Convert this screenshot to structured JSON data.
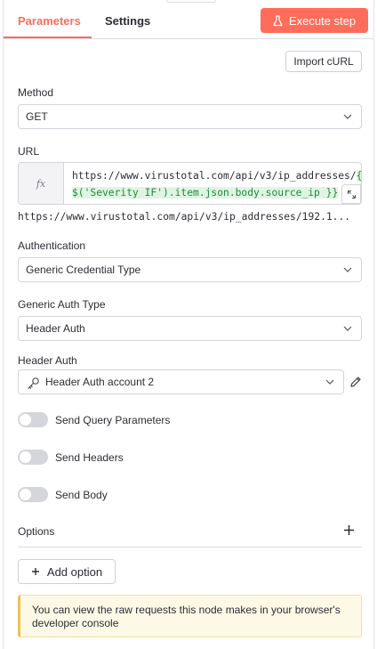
{
  "tabs": [
    {
      "label": "Parameters",
      "active": true
    },
    {
      "label": "Settings",
      "active": false
    }
  ],
  "execute_button": {
    "label": "Execute step",
    "icon": "flask-icon"
  },
  "import_button": {
    "label": "Import cURL"
  },
  "method": {
    "label": "Method",
    "value": "GET"
  },
  "url": {
    "label": "URL",
    "fx_label": "fx",
    "line1_prefix": "https://www.virustotal.com/api/v3/ip_addresses/",
    "line1_expr": "{{",
    "line2_expr": " $('Severity IF').item.json.body.source_ip }}",
    "preview": "https://www.virustotal.com/api/v3/ip_addresses/192.1..."
  },
  "authentication": {
    "label": "Authentication",
    "value": "Generic Credential Type"
  },
  "generic_auth_type": {
    "label": "Generic Auth Type",
    "value": "Header Auth"
  },
  "header_auth": {
    "label": "Header Auth",
    "value": "Header Auth account 2"
  },
  "toggles": [
    {
      "label": "Send Query Parameters",
      "enabled": false
    },
    {
      "label": "Send Headers",
      "enabled": false
    },
    {
      "label": "Send Body",
      "enabled": false
    }
  ],
  "options": {
    "label": "Options",
    "add_label": "Add option"
  },
  "notice": {
    "text": "You can view the raw requests this node makes in your browser's developer console"
  },
  "colors": {
    "accent": "#ff6d5a",
    "expression_bg": "#dff5e2",
    "expression_text": "#1f8a3b",
    "notice_bg": "#fef9e7"
  }
}
